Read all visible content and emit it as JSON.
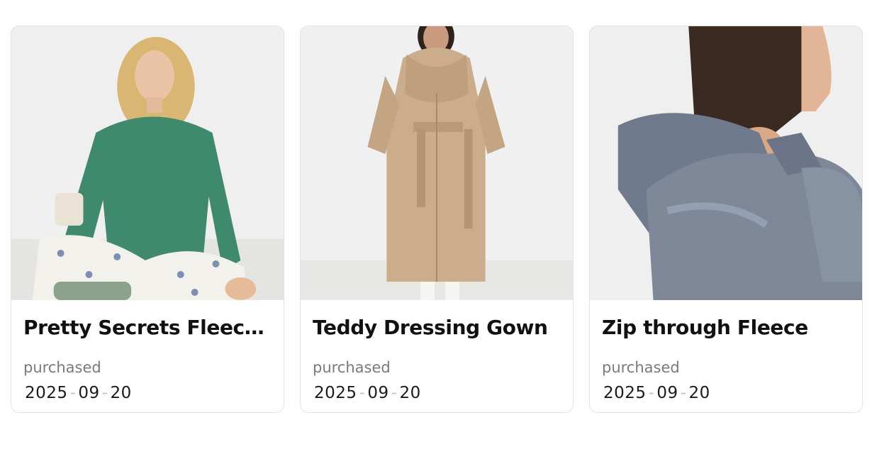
{
  "products": [
    {
      "title": "Pretty Secrets Fleece ...",
      "status_label": "purchased",
      "date_year": "2025",
      "date_month": "09",
      "date_day": "20",
      "date_separator": "-"
    },
    {
      "title": "Teddy Dressing Gown",
      "status_label": "purchased",
      "date_year": "2025",
      "date_month": "09",
      "date_day": "20",
      "date_separator": "-"
    },
    {
      "title": "Zip through Fleece",
      "status_label": "purchased",
      "date_year": "2025",
      "date_month": "09",
      "date_day": "20",
      "date_separator": "-"
    }
  ],
  "colors": {
    "card_border": "#e3e3e3",
    "title_text": "#111111",
    "muted_text": "#7a7a7a",
    "date_separator": "#c4c4c4"
  }
}
